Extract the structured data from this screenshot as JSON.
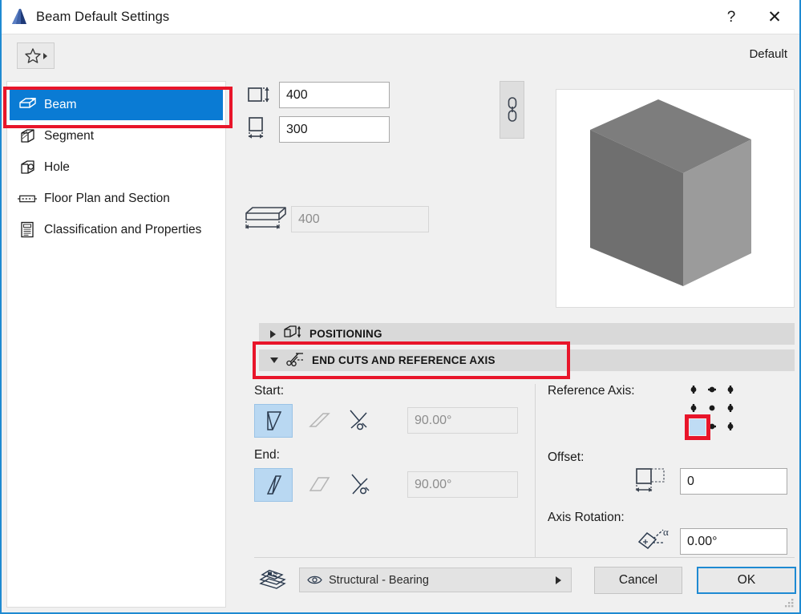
{
  "window": {
    "title": "Beam Default Settings",
    "app_icon": "archicad-logo-icon",
    "help_label": "?",
    "close_label": "✕"
  },
  "toolbar": {
    "favorites_icon": "star-icon",
    "favorites_caret": "caret-right-icon",
    "default_label": "Default"
  },
  "sidebar": {
    "items": [
      {
        "label": "Beam",
        "icon": "beam-icon",
        "selected": true
      },
      {
        "label": "Segment",
        "icon": "segment-icon",
        "selected": false
      },
      {
        "label": "Hole",
        "icon": "hole-icon",
        "selected": false
      },
      {
        "label": "Floor Plan and Section",
        "icon": "floor-plan-icon",
        "selected": false
      },
      {
        "label": "Classification and Properties",
        "icon": "properties-icon",
        "selected": false
      }
    ]
  },
  "dimensions": {
    "height": {
      "icon": "height-dimension-icon",
      "value": "400",
      "disabled": false
    },
    "width": {
      "icon": "width-dimension-icon",
      "value": "300",
      "disabled": false
    },
    "length": {
      "icon": "length-dimension-icon",
      "value": "400",
      "disabled": true
    },
    "link_icon": "chain-link-icon"
  },
  "preview": {
    "icon": "beam-3d-preview",
    "face_top": "#7d7d7d",
    "face_left": "#6f6f6f",
    "face_right": "#9a9a9a"
  },
  "sections": [
    {
      "id": "positioning",
      "label": "POSITIONING",
      "icon": "positioning-icon",
      "expanded": false
    },
    {
      "id": "end_cuts",
      "label": "END CUTS AND REFERENCE AXIS",
      "icon": "end-cuts-icon",
      "expanded": true
    }
  ],
  "end_cuts": {
    "start": {
      "label": "Start:",
      "buttons": [
        {
          "icon": "cut-vertical-icon",
          "active": true
        },
        {
          "icon": "cut-slanted-icon",
          "active": false
        },
        {
          "icon": "cut-custom-angle-icon",
          "active": false
        }
      ],
      "angle": {
        "value": "90.00°",
        "disabled": true
      }
    },
    "end": {
      "label": "End:",
      "buttons": [
        {
          "icon": "cut-vertical-icon",
          "active": true
        },
        {
          "icon": "cut-slanted-icon",
          "active": false
        },
        {
          "icon": "cut-custom-angle-icon",
          "active": false
        }
      ],
      "angle": {
        "value": "90.00°",
        "disabled": true
      }
    }
  },
  "reference_axis": {
    "label": "Reference Axis:",
    "grid_icon": "anchor-grid-icon",
    "selected_cell": "bottom-center",
    "offset": {
      "label": "Offset:",
      "icon": "offset-icon",
      "value": "0"
    },
    "axis_rotation": {
      "label": "Axis Rotation:",
      "icon": "axis-rotation-icon",
      "value": "0.00°"
    }
  },
  "footer": {
    "layer_icon": "layers-icon",
    "layer_combo": {
      "eye_icon": "eye-icon",
      "value": "Structural - Bearing",
      "caret": "caret-right-icon"
    },
    "cancel_label": "Cancel",
    "ok_label": "OK",
    "resize_grip": "resize-grip-icon"
  },
  "highlights": {
    "accent_red": "#e8152a",
    "selection_blue": "#0a7bd4",
    "focus_blue": "#1f8ad2"
  }
}
